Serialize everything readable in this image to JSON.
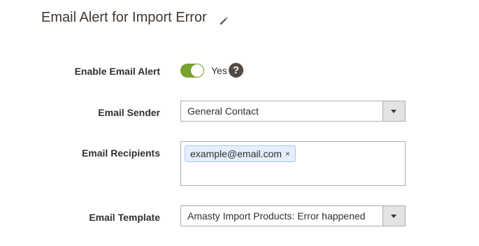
{
  "section": {
    "title": "Email Alert for Import Error",
    "edit_icon": "pencil-icon"
  },
  "enable_alert": {
    "label": "Enable Email Alert",
    "value_text": "Yes",
    "enabled": true,
    "help_icon": "question-mark-icon",
    "help_glyph": "?",
    "toggle_color": "#79a22e"
  },
  "sender": {
    "label": "Email Sender",
    "selected": "General Contact"
  },
  "recipients": {
    "label": "Email Recipients",
    "tags": [
      "example@email.com"
    ],
    "remove_glyph": "×",
    "tag_border_color": "#a6c8ff",
    "tag_background_color": "#e5eefc"
  },
  "template": {
    "label": "Email Template",
    "selected": "Amasty Import Products: Error happened"
  }
}
